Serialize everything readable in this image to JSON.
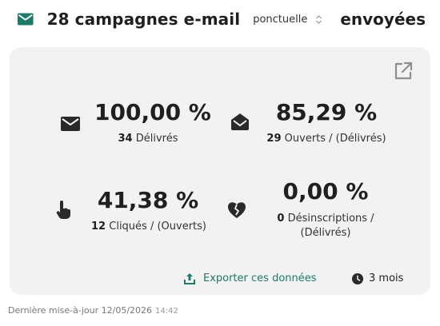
{
  "header": {
    "count_title": "28 campagnes e-mail",
    "type_select": "ponctuelle",
    "suffix": "envoyées"
  },
  "stats": {
    "delivered": {
      "value": "100,00 %",
      "count": "34",
      "label": "Délivrés"
    },
    "opened": {
      "value": "85,29 %",
      "count": "29",
      "label": "Ouverts / (Délivrés)"
    },
    "clicked": {
      "value": "41,38 %",
      "count": "12",
      "label": "Cliqués / (Ouverts)"
    },
    "unsubscribed": {
      "value": "0,00 %",
      "count": "0",
      "label_line1": "Désinscriptions /",
      "label_line2": "(Délivrés)"
    }
  },
  "footer": {
    "export_label": "Exporter ces données",
    "period_label": "3 mois"
  },
  "updated": {
    "label": "Dernière mise-à-jour 12/05/2026",
    "time": "14:42"
  },
  "colors": {
    "accent": "#1e7b6a",
    "card_bg": "#f1f2f1"
  },
  "icons": [
    "envelope-icon",
    "chevron-updown-icon",
    "external-link-icon",
    "envelope-icon",
    "envelope-open-icon",
    "pointer-hand-icon",
    "broken-heart-icon",
    "upload-icon",
    "clock-icon"
  ]
}
